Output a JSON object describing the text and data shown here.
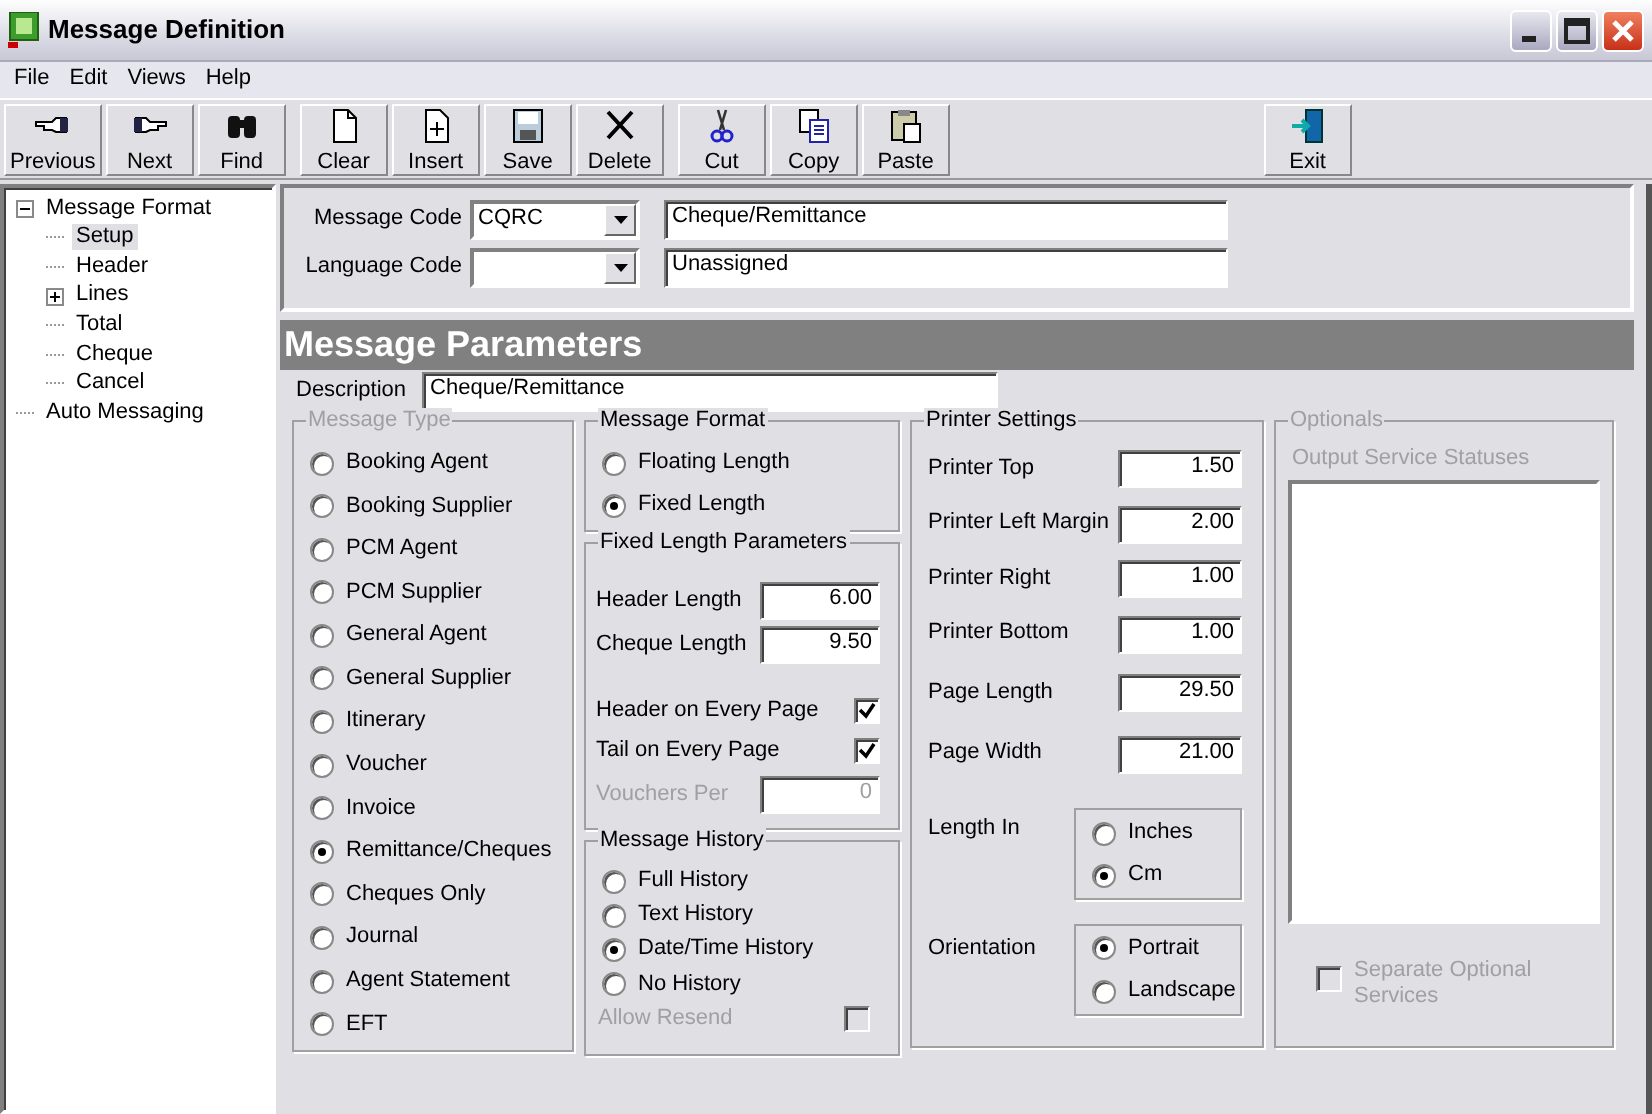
{
  "window": {
    "title": "Message Definition"
  },
  "menu": [
    "File",
    "Edit",
    "Views",
    "Help"
  ],
  "toolbar": [
    [
      {
        "label": "Previous"
      },
      {
        "label": "Next"
      },
      {
        "label": "Find"
      }
    ],
    [
      {
        "label": "Clear"
      },
      {
        "label": "Insert"
      },
      {
        "label": "Save"
      },
      {
        "label": "Delete"
      }
    ],
    [
      {
        "label": "Cut"
      },
      {
        "label": "Copy"
      },
      {
        "label": "Paste"
      }
    ],
    [
      {
        "label": "Exit"
      }
    ]
  ],
  "tree": [
    {
      "label": "Message Format",
      "expanded": true,
      "selected": false,
      "children": [
        {
          "label": "Setup",
          "selected": true
        },
        {
          "label": "Header",
          "selected": false
        },
        {
          "label": "Lines",
          "expanded": false,
          "selected": false
        },
        {
          "label": "Total",
          "selected": false
        },
        {
          "label": "Cheque",
          "selected": false
        },
        {
          "label": "Cancel",
          "selected": false
        }
      ]
    },
    {
      "label": "Auto Messaging",
      "selected": false
    }
  ],
  "header_form": {
    "rows": [
      {
        "label": "Message Code",
        "code": "CQRC",
        "name": "Cheque/Remittance"
      },
      {
        "label": "Language Code",
        "name": "Unassigned"
      }
    ]
  },
  "parameters": {
    "title": "Message Parameters",
    "description_label": "Description",
    "description": "Cheque/Remittance",
    "message_type": {
      "title": "Message Type",
      "disabled": true,
      "options": [
        {
          "label": "Booking Agent",
          "selected": false
        },
        {
          "label": "Booking Supplier",
          "selected": false
        },
        {
          "label": "PCM Agent",
          "selected": false
        },
        {
          "label": "PCM Supplier",
          "selected": false
        },
        {
          "label": "General Agent",
          "selected": false
        },
        {
          "label": "General Supplier",
          "selected": false
        },
        {
          "label": "Itinerary",
          "selected": false
        },
        {
          "label": "Voucher",
          "selected": false
        },
        {
          "label": "Invoice",
          "selected": false
        },
        {
          "label": "Remittance/Cheques",
          "selected": true
        },
        {
          "label": "Cheques Only",
          "selected": false
        },
        {
          "label": "Journal",
          "selected": false
        },
        {
          "label": "Agent Statement",
          "selected": false
        },
        {
          "label": "EFT",
          "selected": false
        }
      ]
    },
    "message_format": {
      "title": "Message Format",
      "options": [
        {
          "label": "Floating Length",
          "selected": false
        },
        {
          "label": "Fixed Length",
          "selected": true
        }
      ]
    },
    "fixed_length_parameters": {
      "title": "Fixed Length Parameters",
      "items": [
        {
          "kind": "field",
          "label": "Header Length",
          "value": "6.00",
          "disabled": false
        },
        {
          "kind": "field",
          "label": "Cheque Length",
          "value": "9.50",
          "disabled": false
        },
        {
          "kind": "checkbox",
          "label": "Header on Every Page",
          "checked": true,
          "disabled": false
        },
        {
          "kind": "checkbox",
          "label": "Tail on Every Page",
          "checked": true,
          "disabled": false
        },
        {
          "kind": "field",
          "label": "Vouchers Per",
          "value": "0",
          "disabled": true
        }
      ]
    },
    "message_history": {
      "title": "Message History",
      "options": [
        {
          "label": "Full History",
          "selected": false
        },
        {
          "label": "Text History",
          "selected": false
        },
        {
          "label": "Date/Time History",
          "selected": true
        },
        {
          "label": "No History",
          "selected": false
        }
      ],
      "allow_resend": {
        "label": "Allow Resend",
        "checked": false,
        "disabled": true
      }
    },
    "printer_settings": {
      "title": "Printer Settings",
      "fields": [
        {
          "label": "Printer Top",
          "value": "1.50"
        },
        {
          "label": "Printer Left Margin",
          "value": "2.00"
        },
        {
          "label": "Printer Right",
          "value": "1.00"
        },
        {
          "label": "Printer Bottom",
          "value": "1.00"
        },
        {
          "label": "Page Length",
          "value": "29.50"
        },
        {
          "label": "Page Width",
          "value": "21.00"
        }
      ],
      "length_in": {
        "label": "Length In",
        "options": [
          {
            "label": "Inches",
            "selected": false
          },
          {
            "label": "Cm",
            "selected": true
          }
        ]
      },
      "orientation": {
        "label": "Orientation",
        "options": [
          {
            "label": "Portrait",
            "selected": true
          },
          {
            "label": "Landscape",
            "selected": false
          }
        ]
      }
    },
    "optionals": {
      "title": "Optionals",
      "disabled": true,
      "list_label": "Output Service Statuses",
      "separate": {
        "label": "Separate Optional Services",
        "checked": false,
        "disabled": true
      }
    }
  }
}
